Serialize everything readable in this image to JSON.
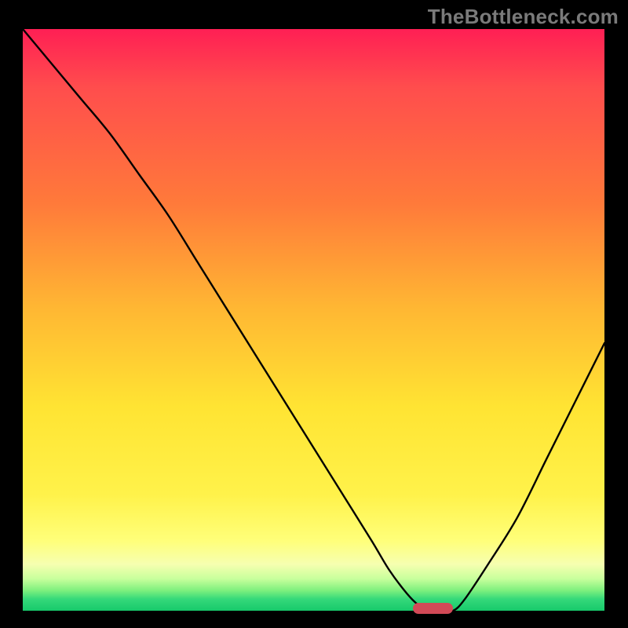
{
  "watermark": "TheBottleneck.com",
  "colors": {
    "background": "#000000",
    "watermark_text": "#7a7a7a",
    "curve": "#000000",
    "marker": "#d24a57",
    "gradient_top": "#ff1f54",
    "gradient_bottom": "#17c96b"
  },
  "chart_data": {
    "type": "line",
    "title": "",
    "xlabel": "",
    "ylabel": "",
    "xlim": [
      0,
      100
    ],
    "ylim": [
      0,
      100
    ],
    "grid": false,
    "legend": false,
    "marker": {
      "x_start": 67,
      "x_end": 74,
      "y": 0
    },
    "series": [
      {
        "name": "bottleneck-curve",
        "x": [
          0,
          5,
          10,
          15,
          20,
          25,
          30,
          35,
          40,
          45,
          50,
          55,
          60,
          63,
          66,
          68,
          70,
          72,
          74,
          76,
          80,
          85,
          90,
          95,
          100
        ],
        "y": [
          100,
          94,
          88,
          82,
          75,
          68,
          60,
          52,
          44,
          36,
          28,
          20,
          12,
          7,
          3,
          1,
          0,
          0,
          0,
          2,
          8,
          16,
          26,
          36,
          46
        ]
      }
    ]
  }
}
